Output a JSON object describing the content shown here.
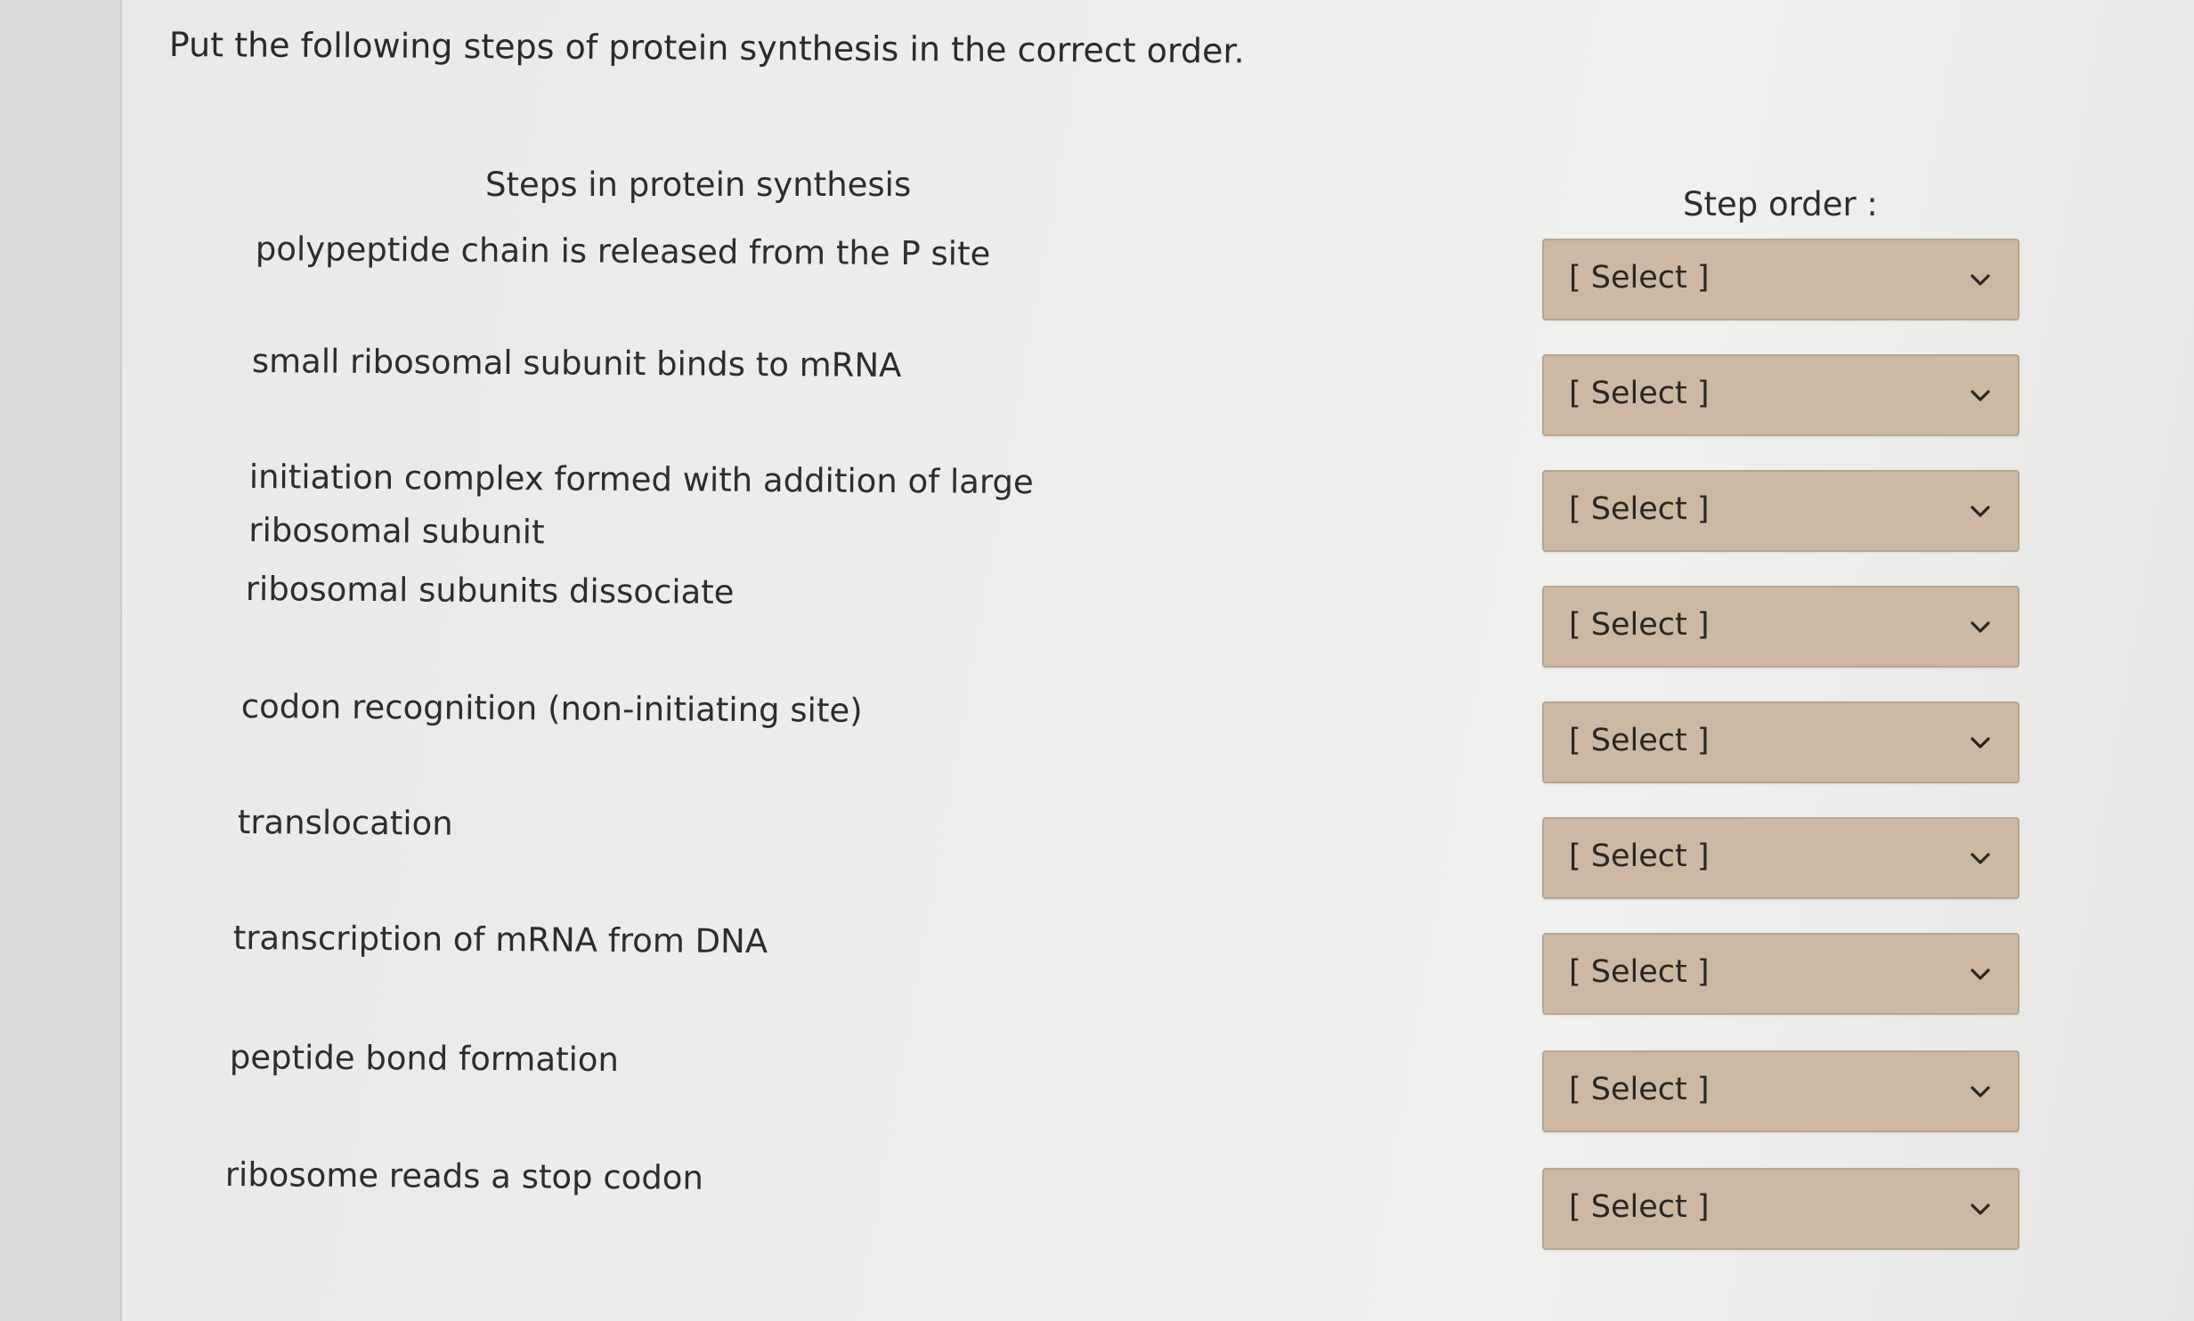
{
  "question": "Put the following steps of protein synthesis in the correct order.",
  "steps_header": "Steps in protein synthesis",
  "order_header": "Step order :",
  "steps": [
    {
      "line1": "polypeptide chain is released from the P site",
      "line2": ""
    },
    {
      "line1": "small ribosomal subunit binds to mRNA",
      "line2": ""
    },
    {
      "line1": "initiation complex formed with addition of large",
      "line2": "ribosomal subunit"
    },
    {
      "line1": "ribosomal subunits dissociate",
      "line2": ""
    },
    {
      "line1": "codon recognition (non-initiating site)",
      "line2": ""
    },
    {
      "line1": "translocation",
      "line2": ""
    },
    {
      "line1": "transcription of mRNA from DNA",
      "line2": ""
    },
    {
      "line1": "peptide bond formation",
      "line2": ""
    },
    {
      "line1": "ribosome reads a stop codon",
      "line2": ""
    }
  ],
  "selects": [
    {
      "value": "[ Select ]"
    },
    {
      "value": "[ Select ]"
    },
    {
      "value": "[ Select ]"
    },
    {
      "value": "[ Select ]"
    },
    {
      "value": "[ Select ]"
    },
    {
      "value": "[ Select ]"
    },
    {
      "value": "[ Select ]"
    },
    {
      "value": "[ Select ]"
    },
    {
      "value": "[ Select ]"
    }
  ],
  "icons": {
    "dropdown": "chevron-down-icon"
  },
  "colors": {
    "select_bg": "#cdb9a3",
    "select_border": "#b6a592",
    "text": "#2d2d2d"
  }
}
